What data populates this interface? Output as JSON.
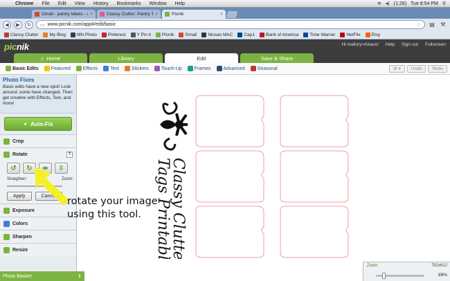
{
  "menubar": {
    "app": "Chrome",
    "items": [
      "File",
      "Edit",
      "View",
      "History",
      "Bookmarks",
      "Window",
      "Help"
    ],
    "status": "(1:26)",
    "clock": "Tue 8:54 PM"
  },
  "tabs": [
    {
      "label": "Gmail - pantry labels - clas",
      "color": "#d44638",
      "active": false
    },
    {
      "label": "Classy Clutter: Pantry Tags",
      "color": "#e45a9a",
      "active": false
    },
    {
      "label": "Picnik",
      "color": "#7cb342",
      "active": true
    }
  ],
  "toolbar": {
    "url": "www.picnik.com/app#/edit/basic"
  },
  "bookmarks": [
    {
      "label": "Classy Clutter",
      "color": "#c0392b"
    },
    {
      "label": "My Blog",
      "color": "#e67e22"
    },
    {
      "label": "MN Photo",
      "color": "#2c3e50"
    },
    {
      "label": "Pinterest",
      "color": "#cb2027"
    },
    {
      "label": "Y Pin it",
      "color": "#555"
    },
    {
      "label": "Picnik",
      "color": "#7cb342"
    },
    {
      "label": "Gmail",
      "color": "#d44638"
    },
    {
      "label": "Nissan MAC",
      "color": "#333"
    },
    {
      "label": "Cap1",
      "color": "#004977"
    },
    {
      "label": "Bank of America",
      "color": "#c41230"
    },
    {
      "label": "Time Warner",
      "color": "#0a4d8c"
    },
    {
      "label": "NetFlix",
      "color": "#b9090b"
    },
    {
      "label": "Etsy",
      "color": "#f56400"
    }
  ],
  "picnik": {
    "logo_icon": "pic",
    "logo_text": "nik",
    "user": "Hi mallory=/lolaus!",
    "help": "Help",
    "signout": "Sign out",
    "fullscreen": "Fullscreen",
    "tabs": [
      "Home",
      "Library",
      "Edit",
      "Save & Share"
    ],
    "active_tab": "Edit"
  },
  "subnav": {
    "items": [
      {
        "label": "Basic Edits",
        "color": "#7cb342",
        "active": true
      },
      {
        "label": "Featured",
        "color": "#f1c40f",
        "active": false
      },
      {
        "label": "Effects",
        "color": "#7cb342",
        "active": false
      },
      {
        "label": "Text",
        "color": "#3b7dd8",
        "active": false
      },
      {
        "label": "Stickers",
        "color": "#e67e22",
        "active": false
      },
      {
        "label": "Touch-Up",
        "color": "#9b59b6",
        "active": false
      },
      {
        "label": "Frames",
        "color": "#16a085",
        "active": false
      },
      {
        "label": "Advanced",
        "color": "#2a4d7a",
        "active": false
      },
      {
        "label": "Seasonal",
        "color": "#c0392b",
        "active": false
      }
    ],
    "undo": "Undo",
    "redo": "Redo"
  },
  "leftpanel": {
    "fixes_title": "Photo Fixes",
    "fixes_body": "Basic edits have a new spot! Look around; some have changed. Then get creative with Effects, Text, and more!",
    "autofix": "Auto-Fix",
    "crop": "Crop",
    "rotate": "Rotate",
    "straighten": "Straighten:",
    "zoom_label": "Zoom:",
    "apply": "Apply",
    "cancel": "Cancel",
    "exposure": "Exposure",
    "colors": "Colors",
    "sharpen": "Sharpen",
    "resize": "Resize",
    "basket": "Photo Basket"
  },
  "zoom": {
    "label": "Zoom",
    "size": "792x612",
    "percent": "89%",
    "level": 0.89
  },
  "annotation": {
    "line1": "rotate your image",
    "line2": "using this tool.",
    "color": "#f3f02a"
  },
  "photo": {
    "text1": "Classy Clutter",
    "text2": "Tags Printable"
  }
}
